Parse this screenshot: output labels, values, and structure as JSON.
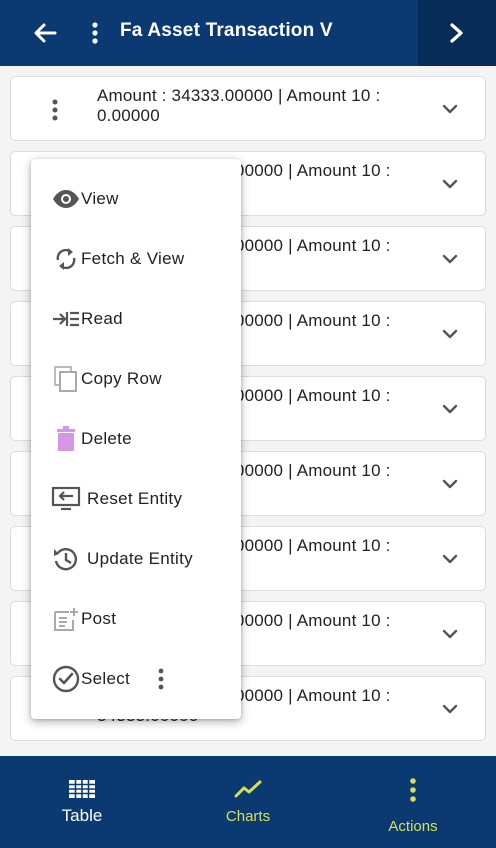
{
  "header": {
    "title": "Fa Asset Transaction V"
  },
  "list": {
    "rows": [
      {
        "line1": "Amount  : 34333.00000 | Amount 10 :",
        "line2": "0.00000"
      },
      {
        "line1": ".00000 | Amount 10 :",
        "line2": ""
      },
      {
        "line1": ".00000 | Amount 10 :",
        "line2": ""
      },
      {
        "line1": ".00000 | Amount 10 :",
        "line2": ""
      },
      {
        "line1": ".00000 | Amount 10 :",
        "line2": ""
      },
      {
        "line1": ".00000 | Amount 10 :",
        "line2": ""
      },
      {
        "line1": ".00000 | Amount 10 :",
        "line2": ""
      },
      {
        "line1": ".00000 | Amount 10 :",
        "line2": ""
      },
      {
        "line1": ".00000 | Amount 10 :",
        "line2": "34333.00000"
      }
    ]
  },
  "menu": {
    "items": [
      {
        "label": "View",
        "icon": "eye-icon"
      },
      {
        "label": "Fetch & View",
        "icon": "refresh-icon"
      },
      {
        "label": "Read",
        "icon": "read-icon"
      },
      {
        "label": "Copy Row",
        "icon": "copy-icon"
      },
      {
        "label": "Delete",
        "icon": "trash-icon"
      },
      {
        "label": "Reset Entity",
        "icon": "reset-icon"
      },
      {
        "label": "Update Entity",
        "icon": "history-icon"
      },
      {
        "label": "Post",
        "icon": "post-icon"
      },
      {
        "label": "Select",
        "icon": "check-circle-icon"
      }
    ]
  },
  "bottom_nav": {
    "table": "Table",
    "charts": "Charts",
    "actions": "Actions"
  },
  "colors": {
    "header_bg": "#0b3a72",
    "header_next_bg": "#082c58",
    "active_nav": "#d4e157",
    "delete_icon": "#d596e4"
  }
}
